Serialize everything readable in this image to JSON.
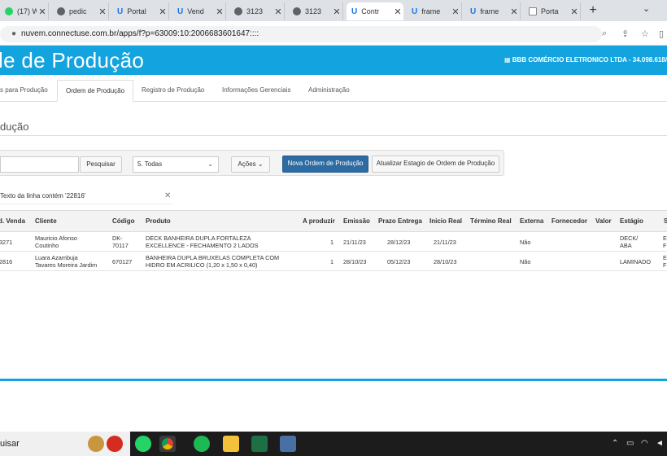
{
  "browser": {
    "tabs": [
      {
        "label": "(17) W",
        "icon": "whatsapp-icon"
      },
      {
        "label": "pedic",
        "icon": "globe-icon"
      },
      {
        "label": "Portal",
        "icon": "u-logo-icon"
      },
      {
        "label": "Vend",
        "icon": "u-logo-icon"
      },
      {
        "label": "3123",
        "icon": "globe-icon"
      },
      {
        "label": "3123",
        "icon": "globe-icon"
      },
      {
        "label": "Contr",
        "icon": "u-logo-icon"
      },
      {
        "label": "frame",
        "icon": "u-logo-icon"
      },
      {
        "label": "frame",
        "icon": "u-logo-icon"
      },
      {
        "label": "Porta",
        "icon": "doc-icon"
      }
    ],
    "url": "nuvem.connectuse.com.br/apps/f?p=63009:10:2006683601647::::"
  },
  "app": {
    "title": "le de Produção",
    "company": "BBB COMÉRCIO ELETRONICO LTDA - 34.098.618/0"
  },
  "nav": {
    "tabs": [
      "s para Produção",
      "Ordem de Produção",
      "Registro de Produção",
      "Informações Gerenciais",
      "Administração"
    ]
  },
  "page": {
    "title": "dução"
  },
  "toolbar": {
    "search_value": "",
    "search_button": "Pesquisar",
    "status_select": "5. Todas",
    "actions_button": "Ações",
    "new_order_button": "Nova Ordem de Produção",
    "update_stage_button": "Atualizar Estagio de Ordem de Produção"
  },
  "filter": {
    "text": "Texto da linha contém '22816'"
  },
  "table": {
    "headers": [
      "d. Venda",
      "Cliente",
      "Código",
      "Produto",
      "A produzir",
      "Emissão",
      "Prazo Entrega",
      "Inicio Real",
      "Término Real",
      "Externa",
      "Fornecedor",
      "Valor",
      "Estágio",
      "S"
    ],
    "rows": [
      {
        "venda": "3271",
        "cliente": [
          "Mauricio Afonso",
          "Coutinho"
        ],
        "codigo": [
          "DK-",
          "70117"
        ],
        "produto": [
          "DECK BANHEIRA DUPLA FORTALEZA",
          "EXCELLENCE - FECHAMENTO 2 LADOS"
        ],
        "a_produzir": "1",
        "emissao": "21/11/23",
        "prazo": "28/12/23",
        "inicio": "21/11/23",
        "termino": "",
        "externa": "Não",
        "fornecedor": "",
        "valor": "",
        "estagio": [
          "DECK/",
          "ABA"
        ],
        "s": [
          "E",
          "F"
        ]
      },
      {
        "venda": "2816",
        "cliente": [
          "Luara Azambuja",
          "Tavares Moreira Jardim"
        ],
        "codigo": [
          "670127",
          ""
        ],
        "produto": [
          "BANHEIRA DUPLA BRUXELAS COMPLETA COM",
          "HIDRO EM ACRILICO (1,20 x 1,50 x 0,40)"
        ],
        "a_produzir": "1",
        "emissao": "28/10/23",
        "prazo": "05/12/23",
        "inicio": "28/10/23",
        "termino": "",
        "externa": "Não",
        "fornecedor": "",
        "valor": "",
        "estagio": [
          "LAMINADO",
          ""
        ],
        "s": [
          "E",
          "F"
        ]
      }
    ]
  },
  "taskbar": {
    "search_text": "uisar"
  },
  "colors": {
    "header_blue": "#13a4df",
    "primary_button": "#2d6ca2"
  }
}
